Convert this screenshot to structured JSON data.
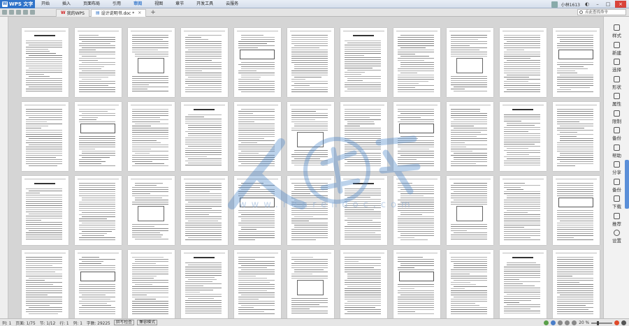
{
  "app": {
    "brand": "WPS 文字",
    "menu": [
      "开始",
      "插入",
      "页面布局",
      "引用",
      "审阅",
      "视图",
      "章节",
      "开发工具",
      "云服务"
    ],
    "active_menu": "审阅",
    "user": "小林1613"
  },
  "tabs": {
    "items": [
      {
        "label": "我的WPS",
        "active": false
      },
      {
        "label": "设计说明书.doc *",
        "active": true
      }
    ],
    "add": "+",
    "search_placeholder": "点此查找命令"
  },
  "sidebar": {
    "items": [
      {
        "label": "样式",
        "icon": "style-icon"
      },
      {
        "label": "新建",
        "icon": "new-icon"
      },
      {
        "label": "选择",
        "icon": "select-icon"
      },
      {
        "label": "形状",
        "icon": "shape-icon"
      },
      {
        "label": "属性",
        "icon": "property-icon"
      },
      {
        "label": "限制",
        "icon": "restrict-icon"
      },
      {
        "label": "备份",
        "icon": "backup-icon"
      },
      {
        "label": "帮助",
        "icon": "help-icon"
      },
      {
        "label": "分享",
        "icon": "share-icon"
      },
      {
        "label": "备份",
        "icon": "backup2-icon"
      },
      {
        "label": "下载",
        "icon": "download-icon"
      },
      {
        "label": "推荐",
        "icon": "recommend-icon"
      },
      {
        "label": "设置",
        "icon": "settings-icon"
      }
    ]
  },
  "status": {
    "row": "列: 1",
    "page": "页面: 1/75",
    "section": "节: 1/12",
    "line": "行: 1",
    "col": "列: 1",
    "words": "字数: 29225",
    "spellcheck": "拼写检查",
    "compat": "兼容模式",
    "zoom": "20 %"
  },
  "watermark": {
    "url": "www.renrendoc.com"
  },
  "colors": {
    "brand": "#2f73c9",
    "watermark": "#4a86c8"
  }
}
